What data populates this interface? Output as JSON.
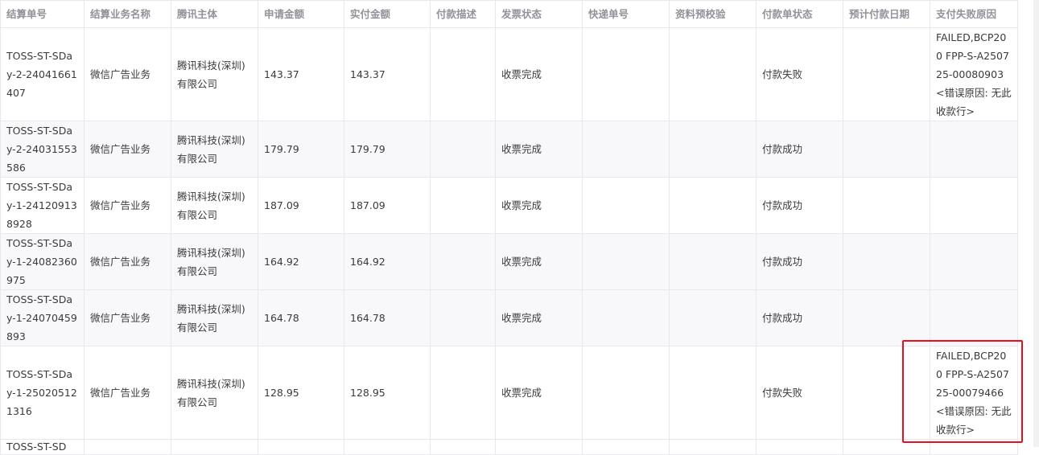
{
  "table": {
    "headers": [
      "结算单号",
      "结算业务名称",
      "腾讯主体",
      "申请金额",
      "实付金额",
      "付款描述",
      "发票状态",
      "快递单号",
      "资料预校验",
      "付款单状态",
      "预计付款日期",
      "支付失败原因"
    ],
    "rows": [
      {
        "order_no": "TOSS-ST-SDay-2-24041661407",
        "business": "微信广告业务",
        "entity": "腾讯科技(深圳)有限公司",
        "apply_amount": "143.37",
        "paid_amount": "143.37",
        "pay_desc": "",
        "invoice_status": "收票完成",
        "express_no": "",
        "precheck": "",
        "pay_status": "付款失败",
        "expected_date": "",
        "fail_reason": "FAILED,BCP200 FPP-S-A250725-00080903<错误原因: 无此收款行>"
      },
      {
        "order_no": "TOSS-ST-SDay-2-24031553586",
        "business": "微信广告业务",
        "entity": "腾讯科技(深圳)有限公司",
        "apply_amount": "179.79",
        "paid_amount": "179.79",
        "pay_desc": "",
        "invoice_status": "收票完成",
        "express_no": "",
        "precheck": "",
        "pay_status": "付款成功",
        "expected_date": "",
        "fail_reason": ""
      },
      {
        "order_no": "TOSS-ST-SDay-1-241209138928",
        "business": "微信广告业务",
        "entity": "腾讯科技(深圳)有限公司",
        "apply_amount": "187.09",
        "paid_amount": "187.09",
        "pay_desc": "",
        "invoice_status": "收票完成",
        "express_no": "",
        "precheck": "",
        "pay_status": "付款成功",
        "expected_date": "",
        "fail_reason": ""
      },
      {
        "order_no": "TOSS-ST-SDay-1-24082360975",
        "business": "微信广告业务",
        "entity": "腾讯科技(深圳)有限公司",
        "apply_amount": "164.92",
        "paid_amount": "164.92",
        "pay_desc": "",
        "invoice_status": "收票完成",
        "express_no": "",
        "precheck": "",
        "pay_status": "付款成功",
        "expected_date": "",
        "fail_reason": ""
      },
      {
        "order_no": "TOSS-ST-SDay-1-24070459893",
        "business": "微信广告业务",
        "entity": "腾讯科技(深圳)有限公司",
        "apply_amount": "164.78",
        "paid_amount": "164.78",
        "pay_desc": "",
        "invoice_status": "收票完成",
        "express_no": "",
        "precheck": "",
        "pay_status": "付款成功",
        "expected_date": "",
        "fail_reason": ""
      },
      {
        "order_no": "TOSS-ST-SDay-1-250205121316",
        "business": "微信广告业务",
        "entity": "腾讯科技(深圳)有限公司",
        "apply_amount": "128.95",
        "paid_amount": "128.95",
        "pay_desc": "",
        "invoice_status": "收票完成",
        "express_no": "",
        "precheck": "",
        "pay_status": "付款失败",
        "expected_date": "",
        "fail_reason": "FAILED,BCP200 FPP-S-A250725-00079466<错误原因: 无此收款行>"
      }
    ],
    "partial_row": {
      "order_no": "TOSS-ST-SD"
    }
  },
  "colors": {
    "highlight": "#e5101d",
    "header_text": "#909399",
    "border": "#e8e8ec",
    "stripe": "#f8f8fb"
  }
}
